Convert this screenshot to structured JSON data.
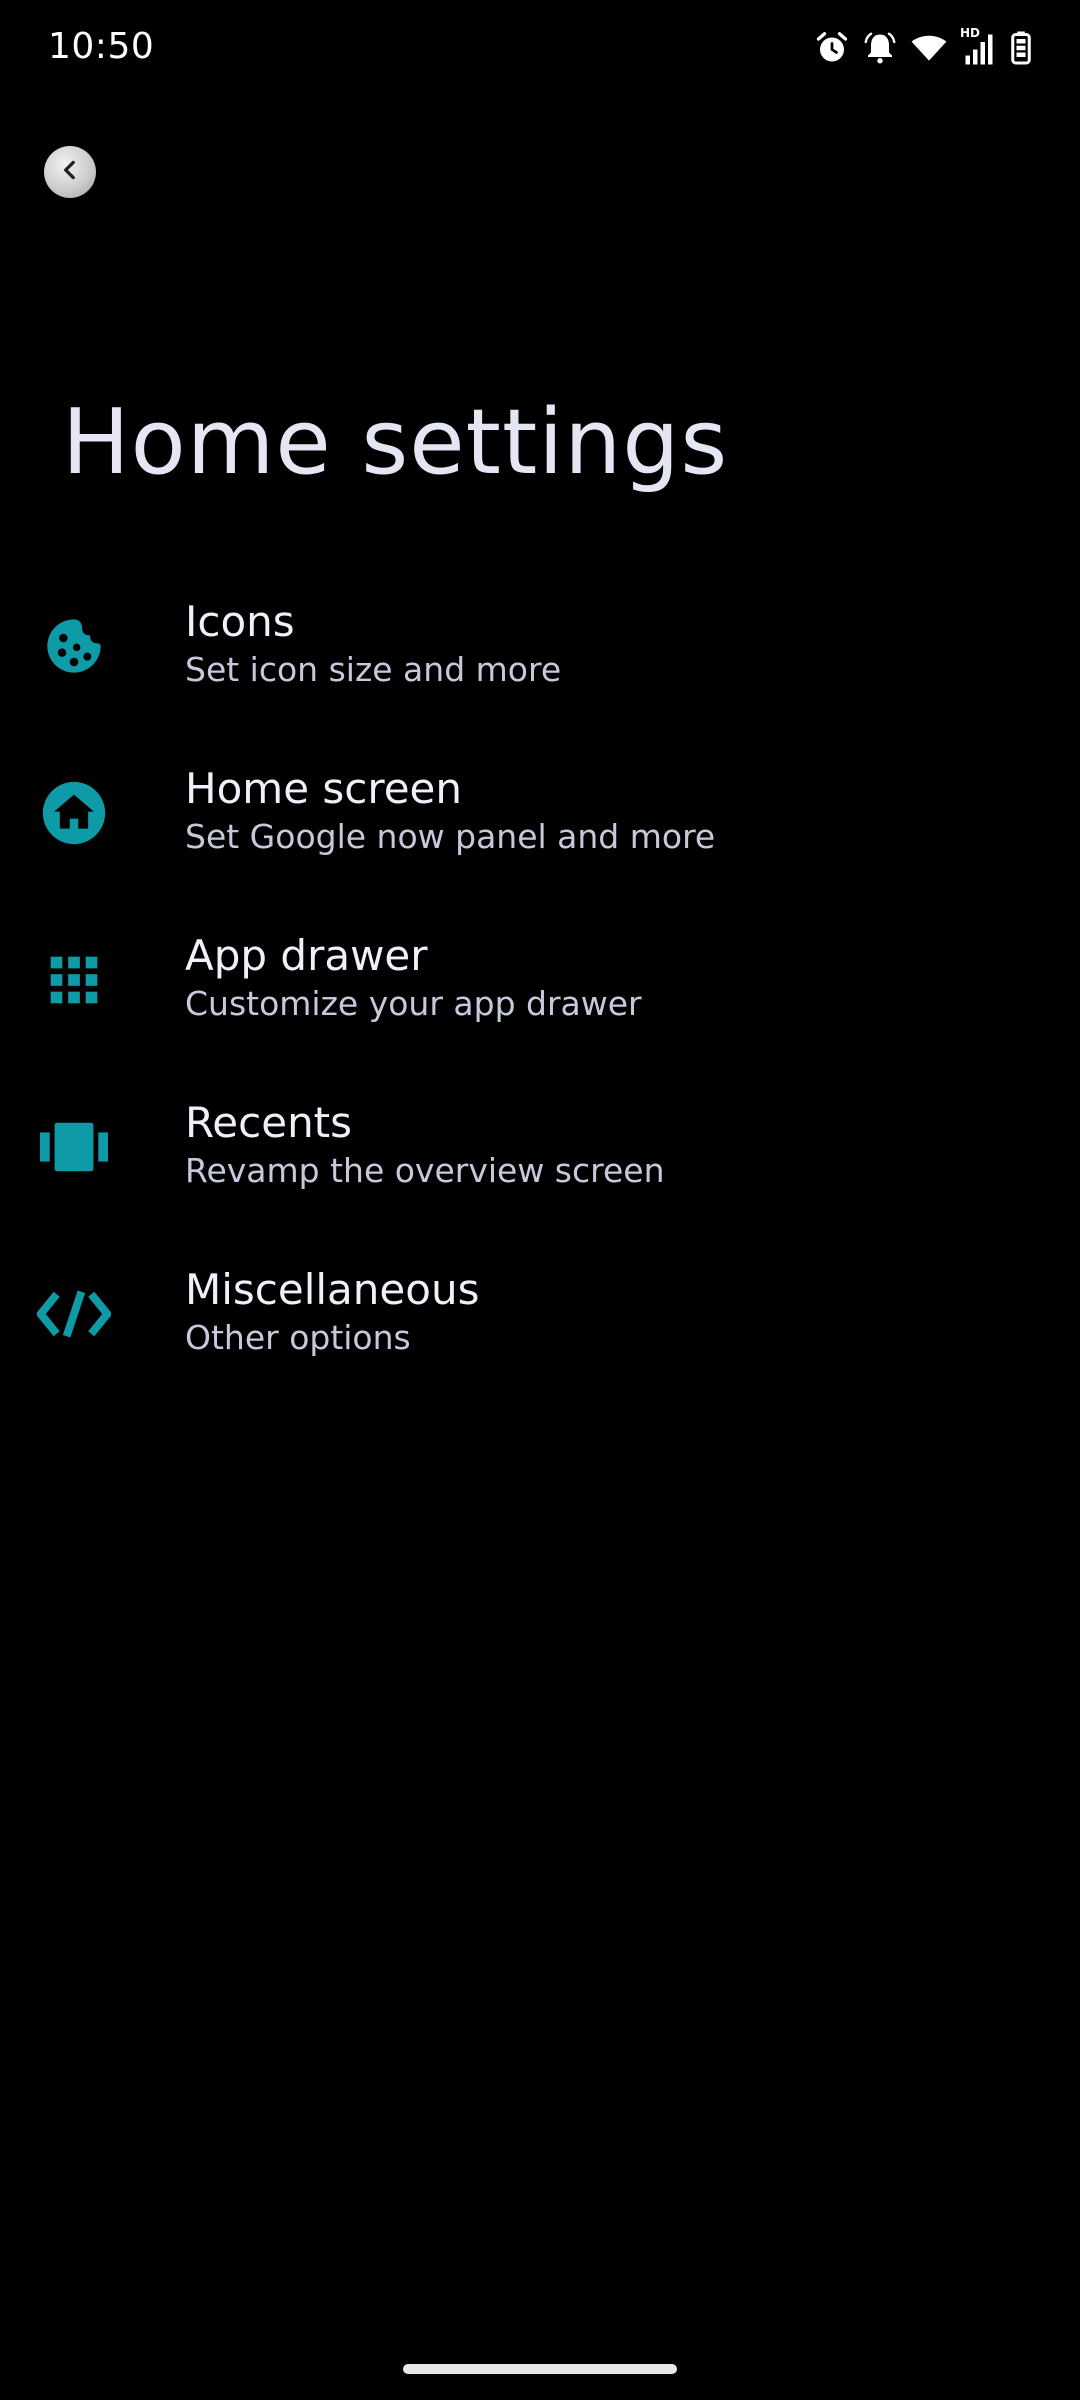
{
  "status_bar": {
    "time": "10:50",
    "icons": [
      "alarm-icon",
      "notification-bell-icon",
      "wifi-icon",
      "hd-signal-icon",
      "battery-icon"
    ],
    "hd_label": "HD"
  },
  "header": {
    "back_icon": "chevron-left-icon",
    "title": "Home settings"
  },
  "accent_color": "#0e9aa7",
  "items": [
    {
      "icon": "palette-icon",
      "title": "Icons",
      "subtitle": "Set icon size and more"
    },
    {
      "icon": "home-icon",
      "title": "Home screen",
      "subtitle": "Set Google now panel and more"
    },
    {
      "icon": "apps-grid-icon",
      "title": "App drawer",
      "subtitle": "Customize your app drawer"
    },
    {
      "icon": "carousel-icon",
      "title": "Recents",
      "subtitle": "Revamp the overview screen"
    },
    {
      "icon": "code-icon",
      "title": "Miscellaneous",
      "subtitle": "Other options"
    }
  ]
}
